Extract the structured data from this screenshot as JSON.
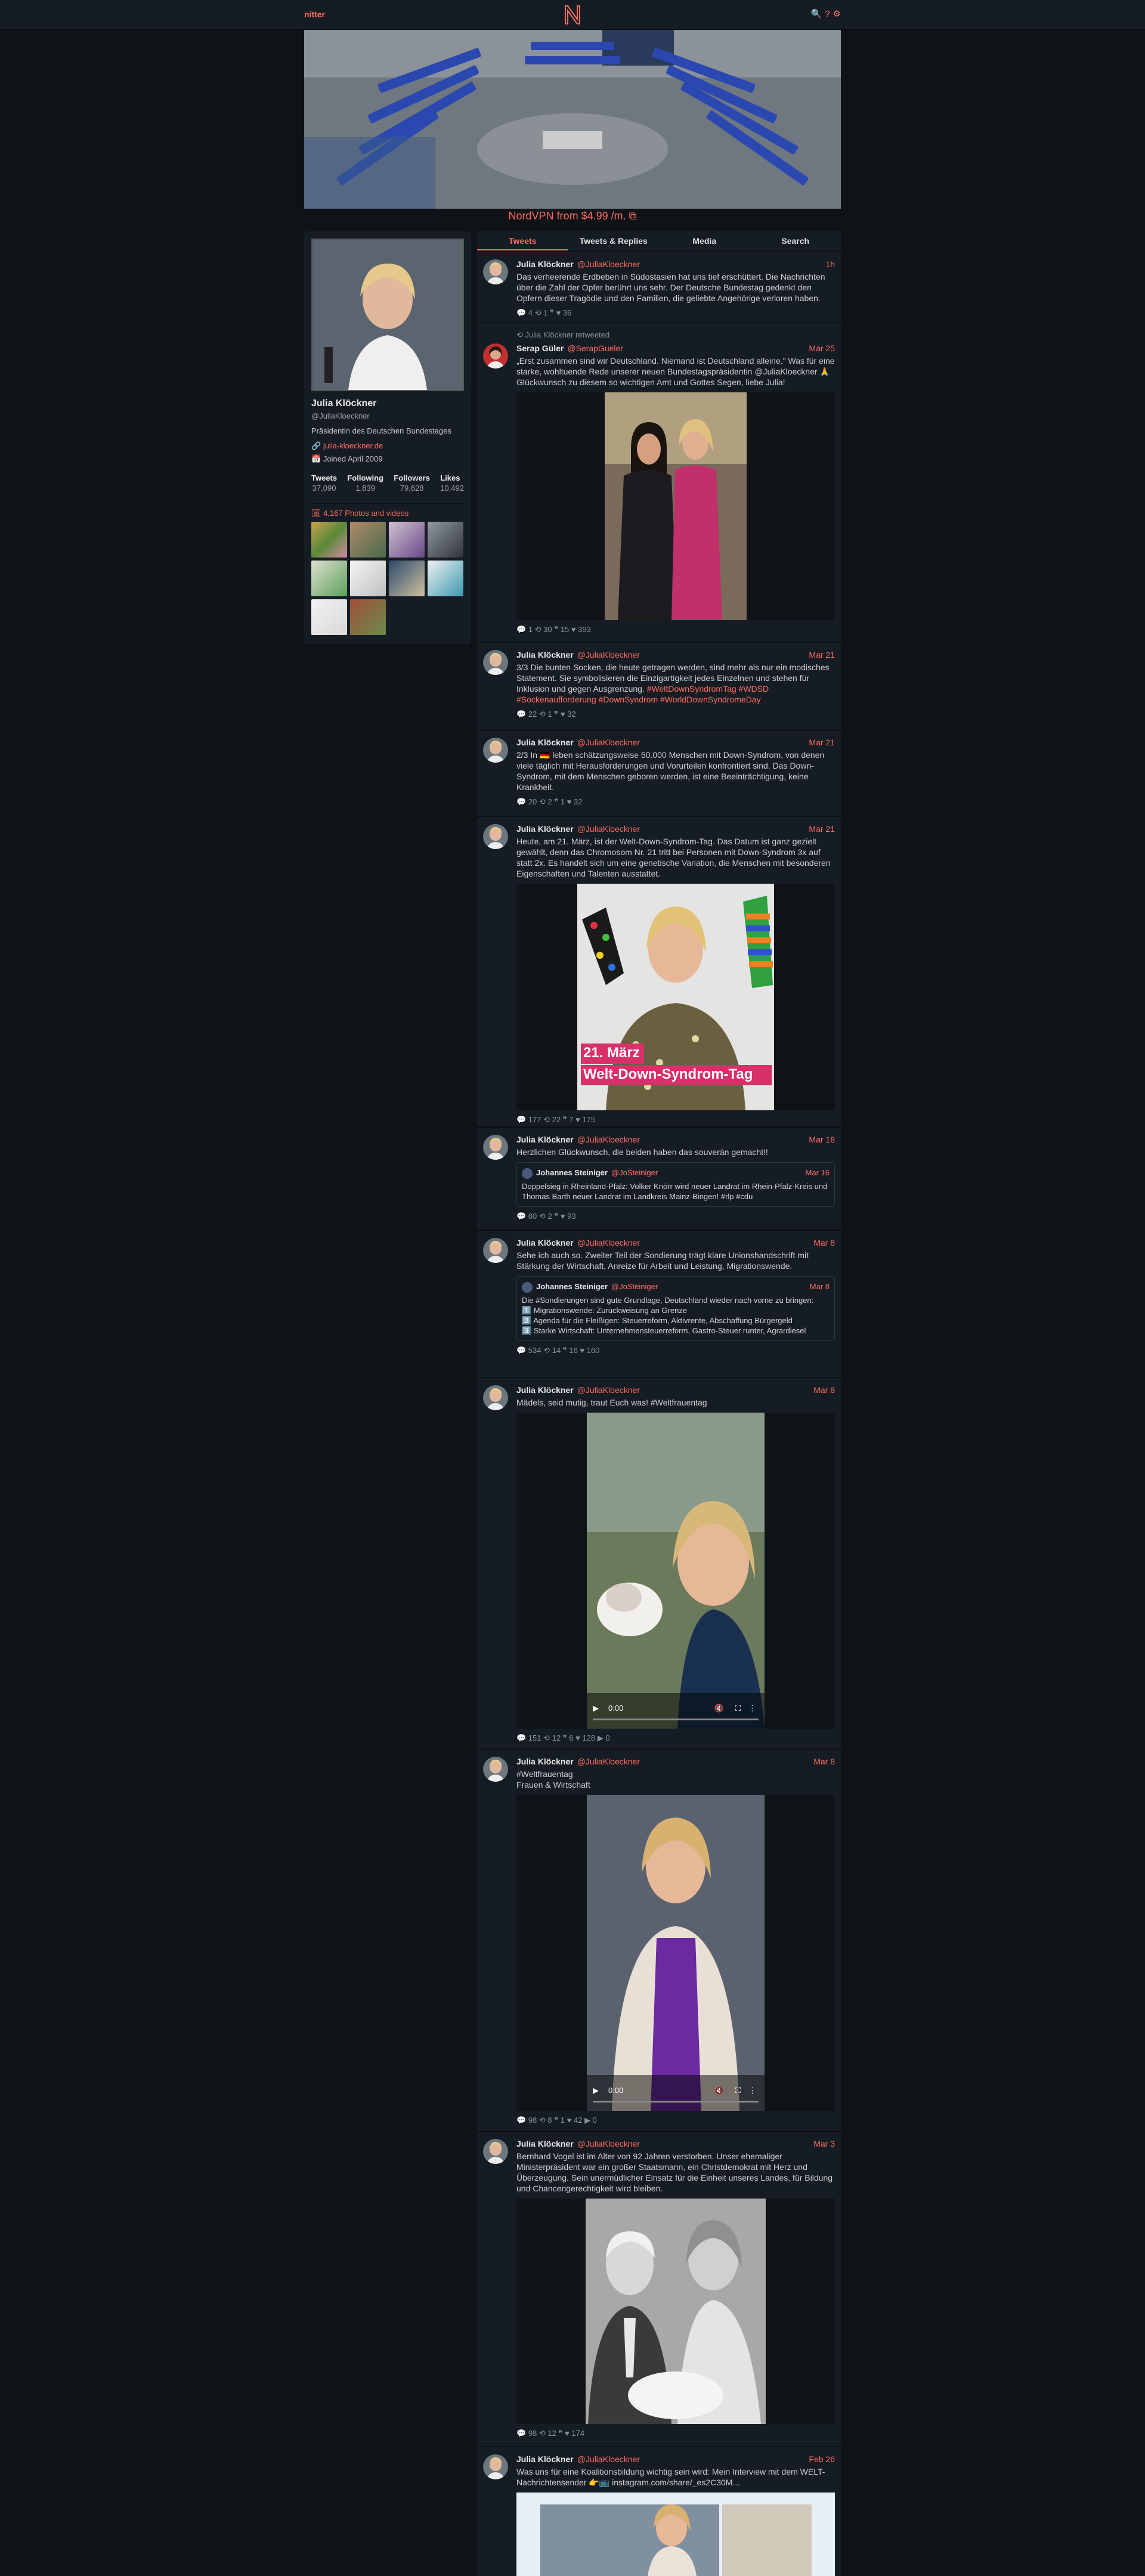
{
  "nav": {
    "brand": "nitter",
    "logo_letter": "N",
    "icons": [
      "search-icon",
      "help-icon",
      "settings-icon"
    ]
  },
  "promo": "NordVPN from $4.99 /m. ⧉",
  "profile": {
    "name": "Julia Klöckner",
    "handle": "@JuliaKloeckner",
    "bio": "Präsidentin des Deutschen Bundestages",
    "website": "julia-kloeckner.de",
    "joined": "Joined April 2009",
    "stats": [
      {
        "label": "Tweets",
        "value": "37,090"
      },
      {
        "label": "Following",
        "value": "1,839"
      },
      {
        "label": "Followers",
        "value": "79,628"
      },
      {
        "label": "Likes",
        "value": "10,492"
      }
    ],
    "media_label": "4,167 Photos and videos"
  },
  "tabs": [
    "Tweets",
    "Tweets & Replies",
    "Media",
    "Search"
  ],
  "tweets": [
    {
      "name": "Julia Klöckner",
      "handle": "@JuliaKloeckner",
      "date": "1h",
      "text": "Das verheerende Erdbeben in Südostasien hat uns tief erschüttert. Die Nachrichten über die Zahl der Opfer berührt uns sehr. Der Deutsche Bundestag gedenkt den Opfern dieser Tragödie und den Familien, die geliebte Angehörige verloren haben.",
      "stats": "💬 4   ⟲ 1   ❞   ♥ 36"
    },
    {
      "retweeted": "⟲ Julia Klöckner retweeted",
      "name": "Serap Güler",
      "handle": "@SerapGueler",
      "date": "Mar 25",
      "text": "„Erst zusammen sind wir Deutschland. Niemand ist Deutschland alleine.\" Was für eine starke, wohltuende Rede unserer neuen Bundestagspräsidentin @JuliaKloeckner 🙏 Glückwunsch zu diesem so wichtigen Amt und Gottes Segen, liebe Julia!",
      "stats": "💬 1   ⟲ 30   ❞ 15   ♥ 393"
    },
    {
      "name": "Julia Klöckner",
      "handle": "@JuliaKloeckner",
      "date": "Mar 21",
      "text": "3/3 Die bunten Socken, die heute getragen werden, sind mehr als nur ein modisches Statement. Sie symbolisieren die Einzigartigkeit jedes Einzelnen und stehen für Inklusion und gegen Ausgrenzung.",
      "tags": "#WeltDownSyndromTag #WDSD #Sockenaufforderung #DownSyndrom #WorldDownSyndromeDay",
      "stats": "💬 22   ⟲ 1   ❞   ♥ 32"
    },
    {
      "name": "Julia Klöckner",
      "handle": "@JuliaKloeckner",
      "date": "Mar 21",
      "text": "2/3 In 🇩🇪 leben schätzungsweise 50.000 Menschen mit Down-Syndrom, von denen viele täglich mit Herausforderungen und Vorurteilen konfrontiert sind. Das Down-Syndrom, mit dem Menschen geboren werden, ist eine Beeinträchtigung, keine Krankheit.",
      "stats": "💬 20   ⟲ 2   ❞ 1   ♥ 32"
    },
    {
      "name": "Julia Klöckner",
      "handle": "@JuliaKloeckner",
      "date": "Mar 21",
      "text": "Heute, am 21. März, ist der Welt-Down-Syndrom-Tag. Das Datum ist ganz gezielt gewählt, denn das Chromosom Nr. 21 tritt bei Personen mit Down-Syndrom 3x auf statt 2x. Es handelt sich um eine genetische Variation, die Menschen mit besonderen Eigenschaften und Talenten ausstattet.",
      "img_text1": "21. März",
      "img_text2": "Welt-Down-Syndrom-Tag",
      "stats": "💬 177   ⟲ 22   ❞ 7   ♥ 175"
    },
    {
      "name": "Julia Klöckner",
      "handle": "@JuliaKloeckner",
      "date": "Mar 18",
      "text": "Herzlichen Glückwunsch, die beiden haben das souverän gemacht!!",
      "quote": {
        "name": "Johannes Steiniger",
        "handle": "@JoSteiniger",
        "date": "Mar 16",
        "text": "Doppelsieg in Rheinland-Pfalz: Volker Knörr wird neuer Landrat im Rhein-Pfalz-Kreis und Thomas Barth neuer Landrat im Landkreis Mainz-Bingen! #rlp #cdu"
      },
      "stats": "💬 60   ⟲ 2   ❞   ♥ 93"
    },
    {
      "name": "Julia Klöckner",
      "handle": "@JuliaKloeckner",
      "date": "Mar 8",
      "text": "Sehe ich auch so. Zweiter Teil der Sondierung trägt klare Unionshandschrift mit Stärkung der Wirtschaft, Anreize für Arbeit und Leistung, Migrationswende.",
      "quote": {
        "name": "Johannes Steiniger",
        "handle": "@JoSteiniger",
        "date": "Mar 8",
        "text": "Die #Sondierungen sind gute Grundlage, Deutschland wieder nach vorne zu bringen:\n1️⃣ Migrationswende: Zurückweisung an Grenze\n2️⃣ Agenda für die Fleißigen: Steuerreform, Aktivrente, Abschaffung Bürgergeld\n3️⃣ Starke Wirtschaft: Unternehmensteuerreform, Gastro-Steuer runter, Agrardiesel"
      },
      "stats": "💬 534   ⟲ 14   ❞ 16   ♥ 160"
    },
    {
      "name": "Julia Klöckner",
      "handle": "@JuliaKloeckner",
      "date": "Mar 8",
      "text": "Mädels, seid mutig, traut Euch was! #Weltfrauentag",
      "video_time": "0:00",
      "stats": "💬 151   ⟲ 12   ❞ 6   ♥ 128   ▶ 0"
    },
    {
      "name": "Julia Klöckner",
      "handle": "@JuliaKloeckner",
      "date": "Mar 8",
      "text": "#Weltfrauentag\nFrauen & Wirtschaft",
      "video_time": "0:00",
      "stats": "💬 98   ⟲ 8   ❞ 1   ♥ 42   ▶ 0"
    },
    {
      "name": "Julia Klöckner",
      "handle": "@JuliaKloeckner",
      "date": "Mar 3",
      "text": "Bernhard Vogel ist im Alter von 92 Jahren verstorben. Unser ehemaliger Ministerpräsident war ein großer Staatsmann, ein Christdemokrat mit Herz und Überzeugung. Sein unermüdlicher Einsatz für die Einheit unseres Landes, für Bildung und Chancengerechtigkeit wird bleiben.",
      "stats": "💬 98   ⟲ 12   ❞   ♥ 174"
    },
    {
      "name": "Julia Klöckner",
      "handle": "@JuliaKloeckner",
      "date": "Feb 26",
      "text": "Was uns für eine Koalitionsbildung wichtig sein wird: Mein Interview mit dem WELT-Nachrichtensender 👉📺 instagram.com/share/_es2C30M...",
      "stats": ""
    }
  ],
  "colors": {
    "accent": "#ff6c60",
    "bg": "#0f1318",
    "panel": "#161c24"
  }
}
